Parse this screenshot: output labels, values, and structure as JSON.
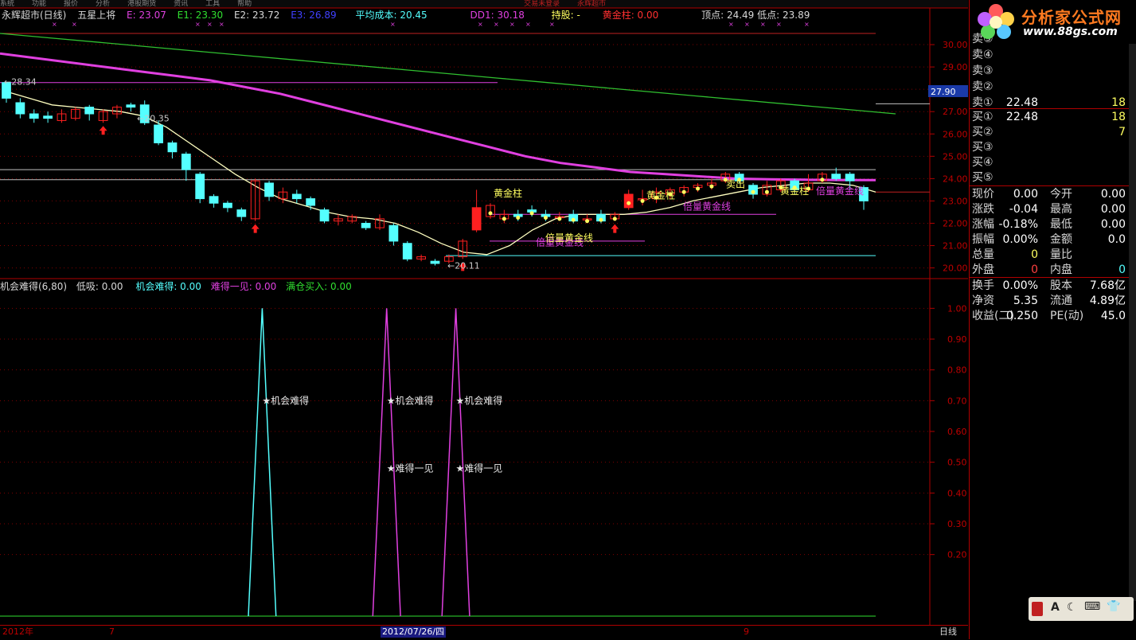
{
  "menu": [
    "系统",
    "功能",
    "报价",
    "分析",
    "港股期货",
    "资讯",
    "工具",
    "帮助",
    "交易未登录",
    "永辉超市"
  ],
  "header": {
    "stock": "永辉超市(日线)",
    "indicator": "五星上将",
    "E": "E: 23.07",
    "E1": "E1: 23.30",
    "E2": "E2: 23.72",
    "E3": "E3: 26.89",
    "avg_cost": "平均成本: 20.45",
    "dd1": "DD1: 30.18",
    "hold": "持股: -",
    "gold_pillar": "黄金柱: 0.00",
    "top_bottom": "顶点: 24.49  低点: 23.89"
  },
  "sub_header": {
    "name": "机会难得(6,80)",
    "dixi": "低吸: 0.00",
    "jihui": "机会难得: 0.00",
    "nande": "难得一见: 0.00",
    "mancang": "满仓买入: 0.00"
  },
  "price_labels": {
    "high": "28.34",
    "mid": "20.35",
    "low": "20.11",
    "current_tag": "27.90"
  },
  "annotations": {
    "gold_pillar_1": "黄金柱",
    "gold_line_1": "倍量黄金线",
    "gold_pillar_2": "黄金柱",
    "gold_line_2": "倍量黄金线",
    "out": "卖出",
    "gold_pillar_3": "黄金柱",
    "gold_line_3": "倍量黄金线"
  },
  "signals": {
    "chance": "★机会难得",
    "rare": "★难得一见"
  },
  "axis_bottom": {
    "year": "2012年",
    "m1": "7",
    "date": "2012/07/26/四",
    "m2": "9",
    "period": "日线"
  },
  "colors": {
    "up": "#ff2020",
    "down": "#54ffff",
    "grid": "#800000",
    "magenta": "#e040e0",
    "yellow": "#ffff60"
  },
  "chart_data": [
    {
      "type": "candlestick",
      "title": "永辉超市(日线)",
      "ylim": [
        19.7,
        31.0
      ],
      "y_ticks": [
        "30.00",
        "29.00",
        "28.00",
        "27.00",
        "26.00",
        "25.00",
        "24.00",
        "23.00",
        "22.00",
        "21.00",
        "20.00"
      ],
      "candles": [
        {
          "o": 28.3,
          "c": 27.6,
          "h": 28.34,
          "l": 27.4
        },
        {
          "o": 27.4,
          "c": 26.9,
          "h": 27.6,
          "l": 26.7
        },
        {
          "o": 26.9,
          "c": 26.7,
          "h": 27.1,
          "l": 26.5
        },
        {
          "o": 26.8,
          "c": 26.7,
          "h": 27.0,
          "l": 26.5
        },
        {
          "o": 26.6,
          "c": 26.9,
          "h": 27.1,
          "l": 26.5
        },
        {
          "o": 26.7,
          "c": 27.1,
          "h": 27.2,
          "l": 26.6
        },
        {
          "o": 27.2,
          "c": 26.9,
          "h": 27.3,
          "l": 26.6
        },
        {
          "o": 26.6,
          "c": 27.0,
          "h": 27.1,
          "l": 26.5
        },
        {
          "o": 26.9,
          "c": 27.2,
          "h": 27.3,
          "l": 26.7
        },
        {
          "o": 27.3,
          "c": 27.2,
          "h": 27.4,
          "l": 27.0
        },
        {
          "o": 27.3,
          "c": 26.5,
          "h": 27.5,
          "l": 26.4
        },
        {
          "o": 26.4,
          "c": 25.6,
          "h": 26.6,
          "l": 25.5
        },
        {
          "o": 25.6,
          "c": 25.2,
          "h": 25.7,
          "l": 24.9
        },
        {
          "o": 25.1,
          "c": 24.4,
          "h": 25.2,
          "l": 23.9
        },
        {
          "o": 24.2,
          "c": 23.1,
          "h": 24.3,
          "l": 22.9
        },
        {
          "o": 23.2,
          "c": 22.9,
          "h": 23.3,
          "l": 22.7
        },
        {
          "o": 22.9,
          "c": 22.7,
          "h": 23.0,
          "l": 22.5
        },
        {
          "o": 22.6,
          "c": 22.3,
          "h": 22.7,
          "l": 22.1
        },
        {
          "o": 22.2,
          "c": 23.9,
          "h": 24.0,
          "l": 22.1
        },
        {
          "o": 23.8,
          "c": 23.2,
          "h": 23.9,
          "l": 23.0
        },
        {
          "o": 23.1,
          "c": 23.4,
          "h": 23.6,
          "l": 22.9
        },
        {
          "o": 23.3,
          "c": 23.1,
          "h": 23.5,
          "l": 22.9
        },
        {
          "o": 23.1,
          "c": 22.8,
          "h": 23.2,
          "l": 22.6
        },
        {
          "o": 22.6,
          "c": 22.1,
          "h": 22.7,
          "l": 22.0
        },
        {
          "o": 22.1,
          "c": 22.2,
          "h": 22.4,
          "l": 21.9
        },
        {
          "o": 22.1,
          "c": 22.3,
          "h": 22.4,
          "l": 22.0
        },
        {
          "o": 22.0,
          "c": 21.8,
          "h": 22.1,
          "l": 21.7
        },
        {
          "o": 21.8,
          "c": 22.2,
          "h": 22.4,
          "l": 21.7
        },
        {
          "o": 21.9,
          "c": 21.2,
          "h": 22.0,
          "l": 21.0
        },
        {
          "o": 21.1,
          "c": 20.4,
          "h": 21.2,
          "l": 20.3
        },
        {
          "o": 20.4,
          "c": 20.5,
          "h": 20.6,
          "l": 20.3
        },
        {
          "o": 20.3,
          "c": 20.2,
          "h": 20.4,
          "l": 20.11
        },
        {
          "o": 20.3,
          "c": 20.5,
          "h": 20.6,
          "l": 20.2
        },
        {
          "o": 20.5,
          "c": 21.2,
          "h": 21.3,
          "l": 20.4
        },
        {
          "o": 21.7,
          "c": 22.7,
          "h": 23.5,
          "l": 21.6
        },
        {
          "o": 22.3,
          "c": 22.8,
          "h": 22.9,
          "l": 22.2
        },
        {
          "o": 22.2,
          "c": 22.4,
          "h": 22.6,
          "l": 22.0
        },
        {
          "o": 22.4,
          "c": 22.3,
          "h": 22.6,
          "l": 22.1
        },
        {
          "o": 22.6,
          "c": 22.5,
          "h": 22.8,
          "l": 22.3
        },
        {
          "o": 22.4,
          "c": 22.3,
          "h": 22.6,
          "l": 22.1
        },
        {
          "o": 22.3,
          "c": 22.3,
          "h": 22.5,
          "l": 22.1
        },
        {
          "o": 22.4,
          "c": 22.1,
          "h": 22.6,
          "l": 22.0
        },
        {
          "o": 22.2,
          "c": 22.2,
          "h": 22.4,
          "l": 22.0
        },
        {
          "o": 22.4,
          "c": 22.1,
          "h": 22.6,
          "l": 22.0
        },
        {
          "o": 22.2,
          "c": 22.4,
          "h": 22.5,
          "l": 22.1
        },
        {
          "o": 22.7,
          "c": 23.3,
          "h": 23.5,
          "l": 22.6
        },
        {
          "o": 23.1,
          "c": 23.1,
          "h": 23.5,
          "l": 22.8
        },
        {
          "o": 23.1,
          "c": 23.4,
          "h": 23.6,
          "l": 22.9
        },
        {
          "o": 23.3,
          "c": 23.5,
          "h": 23.6,
          "l": 23.1
        },
        {
          "o": 23.4,
          "c": 23.6,
          "h": 23.7,
          "l": 23.2
        },
        {
          "o": 23.6,
          "c": 23.7,
          "h": 23.8,
          "l": 23.4
        },
        {
          "o": 23.7,
          "c": 23.8,
          "h": 24.0,
          "l": 23.5
        },
        {
          "o": 23.9,
          "c": 24.2,
          "h": 24.3,
          "l": 23.8
        },
        {
          "o": 24.2,
          "c": 23.9,
          "h": 24.3,
          "l": 23.8
        },
        {
          "o": 23.7,
          "c": 23.3,
          "h": 23.8,
          "l": 23.1
        },
        {
          "o": 23.3,
          "c": 23.7,
          "h": 23.9,
          "l": 23.2
        },
        {
          "o": 23.5,
          "c": 23.9,
          "h": 24.0,
          "l": 23.4
        },
        {
          "o": 23.9,
          "c": 23.5,
          "h": 24.0,
          "l": 23.3
        },
        {
          "o": 23.5,
          "c": 23.8,
          "h": 24.2,
          "l": 23.4
        },
        {
          "o": 23.9,
          "c": 24.2,
          "h": 24.3,
          "l": 23.8
        },
        {
          "o": 24.2,
          "c": 24.0,
          "h": 24.49,
          "l": 23.9
        },
        {
          "o": 24.2,
          "c": 23.9,
          "h": 24.3,
          "l": 23.5
        },
        {
          "o": 23.6,
          "c": 23.0,
          "h": 23.7,
          "l": 22.6
        }
      ],
      "lines": [
        {
          "name": "E3",
          "color": "#e040e0",
          "values": [
            29.6,
            29.4,
            29.2,
            29.0,
            28.8,
            28.6,
            28.4,
            28.1,
            27.8,
            27.4,
            27.0,
            26.6,
            26.2,
            25.8,
            25.4,
            25.0,
            24.7,
            24.5,
            24.3,
            24.2,
            24.1,
            24.0,
            23.97,
            23.95,
            23.94,
            23.93
          ]
        },
        {
          "name": "E2",
          "color": "#30c030",
          "values": [
            30.5,
            30.3,
            30.1,
            29.9,
            29.7,
            29.5,
            29.3,
            29.1,
            28.9,
            28.7,
            28.5,
            28.3,
            28.1,
            27.9,
            27.7,
            27.5,
            27.3,
            27.1,
            26.9
          ]
        },
        {
          "name": "E",
          "color": "#ffffc0",
          "values": [
            27.9,
            27.6,
            27.3,
            27.2,
            27.1,
            27.0,
            26.8,
            26.3,
            25.6,
            24.9,
            24.2,
            23.6,
            23.1,
            22.8,
            22.5,
            22.3,
            22.2,
            22.0,
            21.6,
            21.1,
            20.7,
            20.6,
            21.0,
            21.7,
            22.2,
            22.4,
            22.4,
            22.4,
            22.5,
            22.7,
            23.0,
            23.2,
            23.4,
            23.6,
            23.7,
            23.8,
            23.8,
            23.7,
            23.4
          ]
        }
      ]
    },
    {
      "type": "line",
      "title": "机会难得(6,80)",
      "ylim": [
        0.0,
        1.05
      ],
      "y_ticks": [
        "1.00",
        "0.90",
        "0.80",
        "0.70",
        "0.60",
        "0.50",
        "0.40",
        "0.30",
        "0.20"
      ],
      "series": [
        {
          "name": "机会难得",
          "color": "#54ffff",
          "x": [
            17.5,
            18.5,
            19.5
          ],
          "values": [
            0,
            1,
            0
          ]
        },
        {
          "name": "难得一见",
          "color": "#e040e0",
          "x": [
            26.5,
            27.5,
            28.5
          ],
          "values": [
            0,
            1,
            0
          ]
        },
        {
          "name": "难得一见",
          "color": "#e040e0",
          "x": [
            31.5,
            32.5,
            33.5
          ],
          "values": [
            0,
            1,
            0
          ]
        }
      ]
    }
  ],
  "quote": {
    "sell": [
      {
        "label": "卖⑤",
        "price": "",
        "vol": ""
      },
      {
        "label": "卖④",
        "price": "",
        "vol": ""
      },
      {
        "label": "卖③",
        "price": "",
        "vol": ""
      },
      {
        "label": "卖②",
        "price": "",
        "vol": ""
      },
      {
        "label": "卖①",
        "price": "22.48",
        "vol": "18"
      }
    ],
    "buy": [
      {
        "label": "买①",
        "price": "22.48",
        "vol": "18"
      },
      {
        "label": "买②",
        "price": "",
        "vol": "7"
      },
      {
        "label": "买③",
        "price": "",
        "vol": ""
      },
      {
        "label": "买④",
        "price": "",
        "vol": ""
      },
      {
        "label": "买⑤",
        "price": "",
        "vol": ""
      }
    ],
    "stats": [
      {
        "l1": "现价",
        "v1": "0.00",
        "l2": "今开",
        "v2": "0.00"
      },
      {
        "l1": "涨跌",
        "v1": "-0.04",
        "l2": "最高",
        "v2": "0.00"
      },
      {
        "l1": "涨幅",
        "v1": "-0.18%",
        "l2": "最低",
        "v2": "0.00"
      },
      {
        "l1": "振幅",
        "v1": "0.00%",
        "l2": "金额",
        "v2": "0.0"
      },
      {
        "l1": "总量",
        "v1": "0",
        "l2": "量比",
        "v2": ""
      },
      {
        "l1": "外盘",
        "v1": "0",
        "l2": "内盘",
        "v2": "0"
      }
    ],
    "fund": [
      {
        "l1": "换手",
        "v1": "0.00%",
        "l2": "股本",
        "v2": "7.68亿"
      },
      {
        "l1": "净资",
        "v1": "5.35",
        "l2": "流通",
        "v2": "4.89亿"
      },
      {
        "l1": "收益(二)",
        "v1": "0.250",
        "l2": "PE(动)",
        "v2": "45.0"
      }
    ]
  },
  "logo": {
    "text": "分析家公式网",
    "url": "www.88gs.com"
  },
  "toolbar": {
    "items": [
      "A",
      "☾",
      "⌨",
      "👕"
    ]
  }
}
